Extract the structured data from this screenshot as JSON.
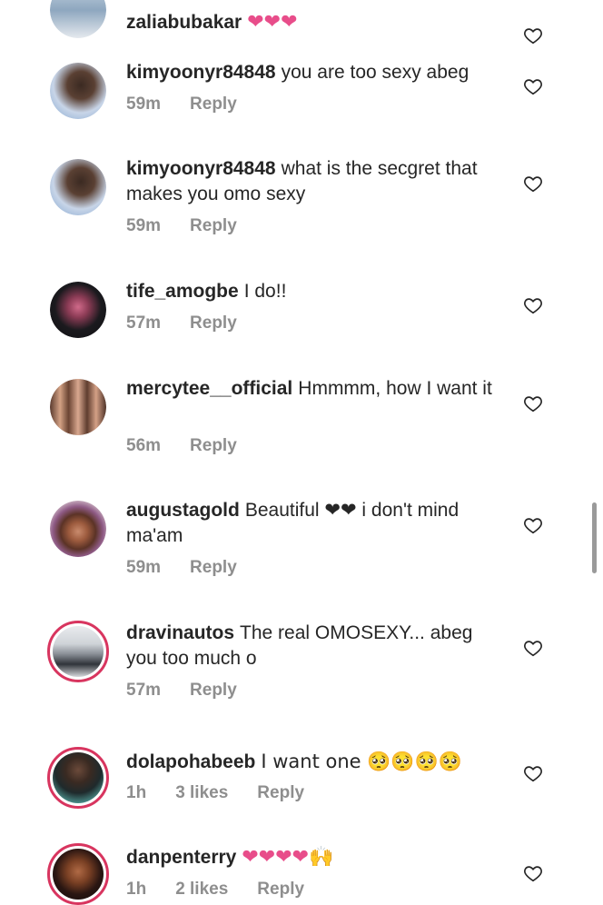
{
  "colors": {
    "text": "#262626",
    "meta": "#8e8e8e",
    "heart_emoji": "#e84d8a",
    "story_ring": "#d8355f",
    "scrollbar": "#9a9a9a"
  },
  "comments": [
    {
      "user": "zaliabubakar",
      "text": "❤❤❤",
      "time": "",
      "likes": "",
      "reply": ""
    },
    {
      "user": "kimyoonyr84848",
      "text": "you are too sexy abeg",
      "time": "59m",
      "likes": "",
      "reply": "Reply"
    },
    {
      "user": "kimyoonyr84848",
      "text": "what is the secgret that makes you omo sexy",
      "time": "59m",
      "likes": "",
      "reply": "Reply"
    },
    {
      "user": "tife_amogbe",
      "text": "I do!!",
      "time": "57m",
      "likes": "",
      "reply": "Reply"
    },
    {
      "user": "mercytee__official",
      "text": "Hmmmm, how I want it",
      "time": "56m",
      "likes": "",
      "reply": "Reply"
    },
    {
      "user": "augustagold",
      "text": "Beautiful ❤❤ i don't mind ma'am",
      "time": "59m",
      "likes": "",
      "reply": "Reply"
    },
    {
      "user": "dravinautos",
      "text": "The real OMOSEXY... abeg you too much o",
      "time": "57m",
      "likes": "",
      "reply": "Reply"
    },
    {
      "user": "dolapohabeeb",
      "text": "I want one 🥺🥺🥺🥺",
      "time": "1h",
      "likes": "3 likes",
      "reply": "Reply"
    },
    {
      "user": "danpenterry",
      "text": "❤❤❤❤🙌",
      "time": "1h",
      "likes": "2 likes",
      "reply": "Reply"
    }
  ],
  "icons": {
    "like": "heart-outline-icon"
  }
}
